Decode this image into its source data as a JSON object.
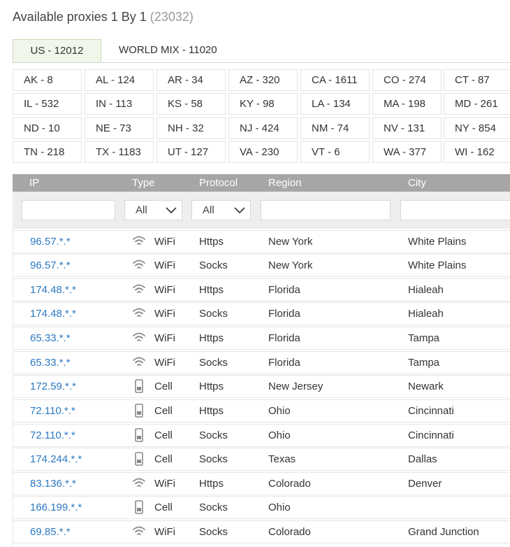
{
  "header": {
    "title": "Available proxies 1 By 1",
    "count": "(23032)"
  },
  "tabs": [
    {
      "label": "US - 12012",
      "active": true
    },
    {
      "label": "WORLD MIX - 11020",
      "active": false
    }
  ],
  "states": [
    [
      "AK - 8",
      "AL - 124",
      "AR - 34",
      "AZ - 320",
      "CA - 1611",
      "CO - 274",
      "CT - 87"
    ],
    [
      "IL - 532",
      "IN - 113",
      "KS - 58",
      "KY - 98",
      "LA - 134",
      "MA - 198",
      "MD - 261"
    ],
    [
      "ND - 10",
      "NE - 73",
      "NH - 32",
      "NJ - 424",
      "NM - 74",
      "NV - 131",
      "NY - 854"
    ],
    [
      "TN - 218",
      "TX - 1183",
      "UT - 127",
      "VA - 230",
      "VT - 6",
      "WA - 377",
      "WI - 162"
    ]
  ],
  "columns": {
    "ip": "IP",
    "type": "Type",
    "protocol": "Protocol",
    "region": "Region",
    "city": "City"
  },
  "filters": {
    "type_selected": "All",
    "protocol_selected": "All"
  },
  "rows": [
    {
      "ip": "96.57.*.*",
      "icon": "wifi-icon",
      "type": "WiFi",
      "protocol": "Https",
      "region": "New York",
      "city": "White Plains"
    },
    {
      "ip": "96.57.*.*",
      "icon": "wifi-icon",
      "type": "WiFi",
      "protocol": "Socks",
      "region": "New York",
      "city": "White Plains"
    },
    {
      "ip": "174.48.*.*",
      "icon": "wifi-icon",
      "type": "WiFi",
      "protocol": "Https",
      "region": "Florida",
      "city": "Hialeah"
    },
    {
      "ip": "174.48.*.*",
      "icon": "wifi-icon",
      "type": "WiFi",
      "protocol": "Socks",
      "region": "Florida",
      "city": "Hialeah"
    },
    {
      "ip": "65.33.*.*",
      "icon": "wifi-icon",
      "type": "WiFi",
      "protocol": "Https",
      "region": "Florida",
      "city": "Tampa"
    },
    {
      "ip": "65.33.*.*",
      "icon": "wifi-icon",
      "type": "WiFi",
      "protocol": "Socks",
      "region": "Florida",
      "city": "Tampa"
    },
    {
      "ip": "172.59.*.*",
      "icon": "cell-icon",
      "type": "Cell",
      "protocol": "Https",
      "region": "New Jersey",
      "city": "Newark"
    },
    {
      "ip": "72.110.*.*",
      "icon": "cell-icon",
      "type": "Cell",
      "protocol": "Https",
      "region": "Ohio",
      "city": "Cincinnati"
    },
    {
      "ip": "72.110.*.*",
      "icon": "cell-icon",
      "type": "Cell",
      "protocol": "Socks",
      "region": "Ohio",
      "city": "Cincinnati"
    },
    {
      "ip": "174.244.*.*",
      "icon": "cell-icon",
      "type": "Cell",
      "protocol": "Socks",
      "region": "Texas",
      "city": "Dallas"
    },
    {
      "ip": "83.136.*.*",
      "icon": "wifi-icon",
      "type": "WiFi",
      "protocol": "Https",
      "region": "Colorado",
      "city": "Denver"
    },
    {
      "ip": "166.199.*.*",
      "icon": "cell-icon",
      "type": "Cell",
      "protocol": "Socks",
      "region": "Ohio",
      "city": ""
    },
    {
      "ip": "69.85.*.*",
      "icon": "wifi-icon",
      "type": "WiFi",
      "protocol": "Socks",
      "region": "Colorado",
      "city": "Grand Junction"
    }
  ]
}
